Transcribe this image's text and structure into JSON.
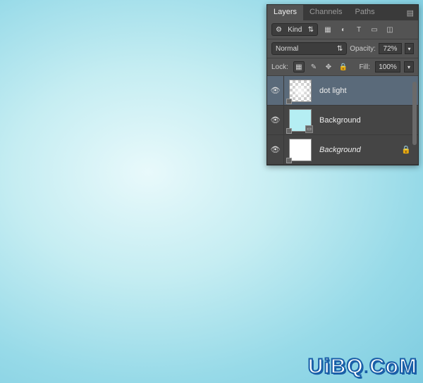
{
  "panel": {
    "tabs": {
      "layers": "Layers",
      "channels": "Channels",
      "paths": "Paths"
    },
    "filter": {
      "kind_label": "Kind",
      "kind_icon": "⚙"
    },
    "blend": {
      "mode": "Normal",
      "opacity_label": "Opacity:",
      "opacity_value": "72%"
    },
    "lock": {
      "label": "Lock:",
      "fill_label": "Fill:",
      "fill_value": "100%"
    }
  },
  "layers": [
    {
      "name": "dot light",
      "selected": true,
      "thumb": "checker"
    },
    {
      "name": "Background",
      "selected": false,
      "thumb": "cyan",
      "shape": true
    },
    {
      "name": "Background",
      "selected": false,
      "thumb": "white",
      "locked": true,
      "italic": true
    }
  ],
  "watermark": {
    "text_a": "UiBQ",
    "text_b": "CoM"
  }
}
